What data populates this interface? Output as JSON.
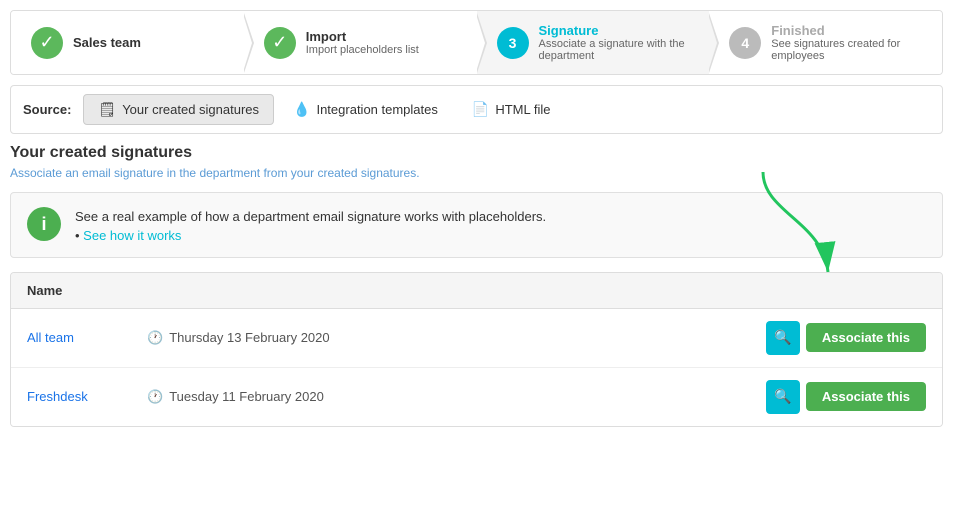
{
  "stepper": {
    "steps": [
      {
        "id": "sales-team",
        "iconType": "check",
        "title": "Sales team",
        "subtitle": "",
        "titleColor": "normal"
      },
      {
        "id": "import",
        "iconType": "check",
        "title": "Import",
        "subtitle": "Import placeholders list",
        "titleColor": "normal"
      },
      {
        "id": "signature",
        "iconType": "circle-teal",
        "number": "3",
        "title": "Signature",
        "subtitle": "Associate a signature with the department",
        "titleColor": "teal"
      },
      {
        "id": "finished",
        "iconType": "circle-gray",
        "number": "4",
        "title": "Finished",
        "subtitle": "See signatures created for employees",
        "titleColor": "gray"
      }
    ]
  },
  "source": {
    "label": "Source:",
    "tabs": [
      {
        "id": "created",
        "icon": "🗒",
        "label": "Your created signatures",
        "active": true
      },
      {
        "id": "integration",
        "icon": "💧",
        "label": "Integration templates",
        "active": false
      },
      {
        "id": "html",
        "icon": "📄",
        "label": "HTML file",
        "active": false
      }
    ]
  },
  "content": {
    "title": "Your created signatures",
    "subtitle": "Associate an email signature in the department from your created signatures.",
    "infoBox": {
      "text": "See a real example of how a department email signature works with placeholders.",
      "linkText": "See how it works"
    },
    "table": {
      "column": "Name",
      "rows": [
        {
          "name": "All team",
          "date": "Thursday 13 February 2020",
          "associateLabel": "Associate this"
        },
        {
          "name": "Freshdesk",
          "date": "Tuesday 11 February 2020",
          "associateLabel": "Associate this"
        }
      ]
    }
  }
}
